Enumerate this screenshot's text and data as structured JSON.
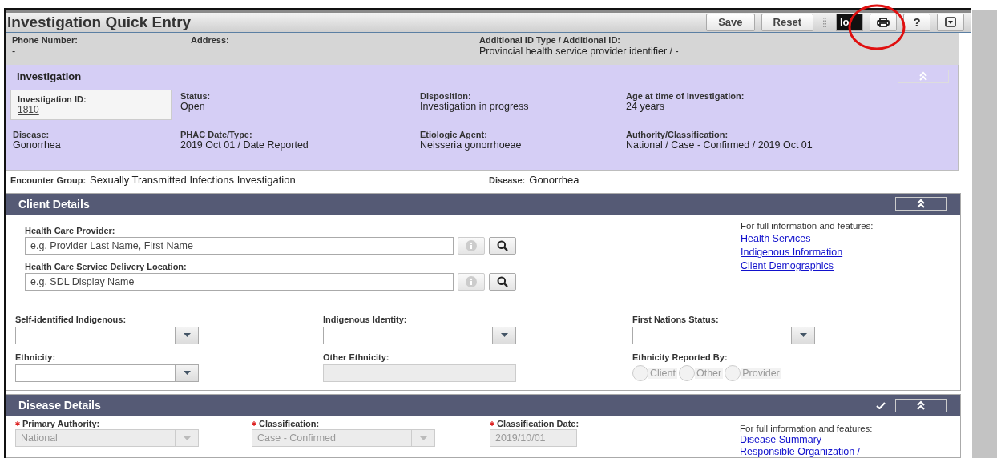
{
  "title": "Investigation Quick Entry",
  "toolbar": [
    {
      "kind": "button",
      "label": "Save"
    },
    {
      "kind": "button",
      "label": "Reset"
    },
    {
      "kind": "grip"
    },
    {
      "kind": "logo",
      "label": "lo"
    },
    {
      "kind": "print"
    },
    {
      "kind": "help",
      "label": "?"
    },
    {
      "kind": "menu"
    }
  ],
  "annotation": {
    "kind": "circle"
  },
  "client_header": [
    {
      "label": "Phone Number:",
      "value": "-"
    },
    {
      "label": "Address:"
    },
    {
      "label": "Additional ID Type / Additional ID:",
      "value": "Provincial health service provider identifier / -"
    }
  ],
  "investigation": {
    "title": "Investigation",
    "expanded": true,
    "fields": [
      {
        "kind": "link",
        "label": "Investigation ID:",
        "value": "1810"
      },
      {
        "kind": "text",
        "label": "Status:",
        "value": "Open"
      },
      {
        "kind": "text",
        "label": "Disposition:",
        "value": "Investigation in progress"
      },
      {
        "kind": "text",
        "label": "Age at time of Investigation:",
        "value": "24 years"
      },
      {
        "kind": "text",
        "label": "Disease:",
        "value": "Gonorrhea"
      },
      {
        "kind": "text",
        "label": "PHAC Date/Type:",
        "value": "2019 Oct 01 / Date Reported"
      },
      {
        "kind": "text",
        "label": "Etiologic Agent:",
        "value": "Neisseria gonorrhoeae"
      },
      {
        "kind": "text",
        "label": "Authority/Classification:",
        "value": "National / Case - Confirmed / 2019 Oct 01"
      }
    ]
  },
  "encounter": [
    {
      "label": "Encounter Group:",
      "value": "Sexually Transmitted Infections Investigation"
    },
    {
      "label": "Disease:",
      "value": "Gonorrhea"
    }
  ],
  "client_details": {
    "title": "Client Details",
    "expanded": true,
    "lookups": [
      {
        "label": "Health Care Provider:",
        "placeholder": "e.g. Provider Last Name, First Name"
      },
      {
        "label": "Health Care Service Delivery Location:",
        "placeholder": "e.g. SDL Display Name"
      }
    ],
    "links_intro": "For full information and features:",
    "links": [
      "Health Services",
      "Indigenous Information",
      "Client Demographics"
    ],
    "fields": [
      {
        "kind": "select",
        "label": "Self-identified Indigenous:",
        "disabled": false
      },
      {
        "kind": "select",
        "label": "Indigenous Identity:",
        "disabled": false
      },
      {
        "kind": "select",
        "label": "First Nations Status:",
        "disabled": false
      },
      {
        "kind": "select",
        "label": "Ethnicity:",
        "disabled": false
      },
      {
        "kind": "text",
        "label": "Other Ethnicity:",
        "disabled": true
      },
      {
        "kind": "radios",
        "label": "Ethnicity Reported By:",
        "disabled": true,
        "options": [
          {
            "label": "Client",
            "selected": false
          },
          {
            "label": "Other",
            "selected": false
          },
          {
            "label": "Provider",
            "selected": false
          }
        ]
      }
    ]
  },
  "disease_details": {
    "title": "Disease Details",
    "expanded": true,
    "complete": true,
    "fields": [
      {
        "kind": "select",
        "label": "Primary Authority:",
        "required": true,
        "disabled": true,
        "value": "National"
      },
      {
        "kind": "select",
        "label": "Classification:",
        "required": true,
        "disabled": true,
        "value": "Case - Confirmed"
      },
      {
        "kind": "text",
        "label": "Classification Date:",
        "required": true,
        "disabled": true,
        "value": "2019/10/01"
      }
    ],
    "links_intro": "For full information and features:",
    "links": [
      "Disease Summary",
      "Responsible Organization /"
    ]
  }
}
